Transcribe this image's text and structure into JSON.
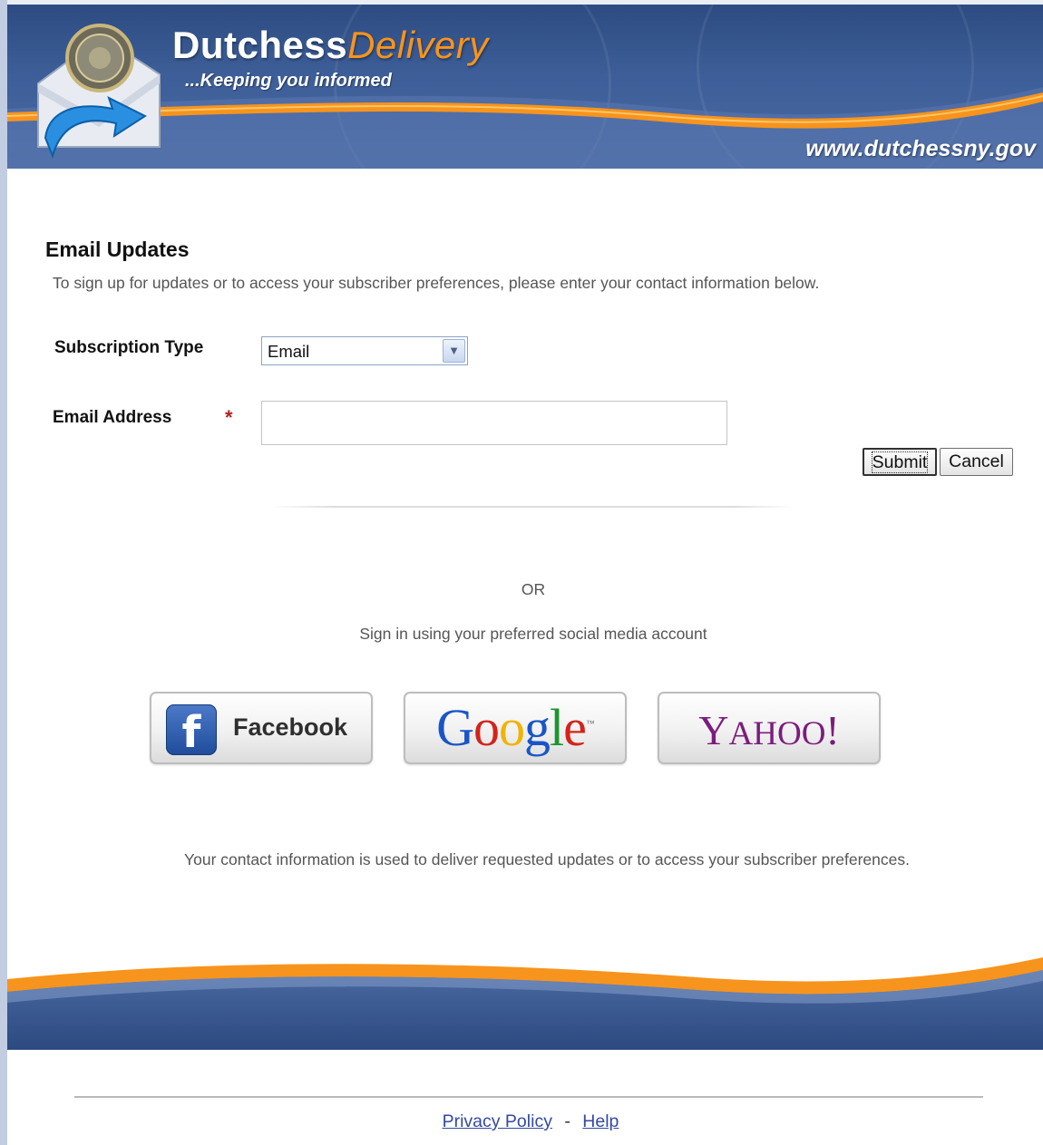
{
  "header": {
    "brand_first": "Dutchess",
    "brand_second": "Delivery",
    "tagline": "...Keeping you informed",
    "site_url": "www.dutchessny.gov"
  },
  "main": {
    "title": "Email Updates",
    "intro": "To sign up for updates or to access your subscriber preferences, please enter your contact information below.",
    "subscription_type_label": "Subscription Type",
    "subscription_type_value": "Email",
    "email_label": "Email Address",
    "required_marker": "*",
    "email_value": "",
    "submit_label": "Submit",
    "cancel_label": "Cancel",
    "or_text": "OR",
    "social_prompt": "Sign in using your preferred social media account",
    "disclaimer": "Your contact information is used to deliver requested updates or to access your subscriber preferences."
  },
  "social": {
    "facebook_label": "Facebook",
    "facebook_icon_glyph": "f",
    "google_label": "Google",
    "yahoo_label": "YAHOO!"
  },
  "footer": {
    "privacy_label": "Privacy Policy",
    "separator": "-",
    "help_label": "Help"
  },
  "colors": {
    "banner_blue": "#3d5e98",
    "accent_orange": "#f7941d",
    "link_blue": "#3349a3",
    "required_red": "#b22222",
    "yahoo_purple": "#7b1c7d",
    "facebook_blue": "#3b5998"
  },
  "icons": {
    "logo": "envelope-with-seal-logo",
    "dropdown": "chevron-down-icon",
    "facebook": "facebook-icon"
  }
}
